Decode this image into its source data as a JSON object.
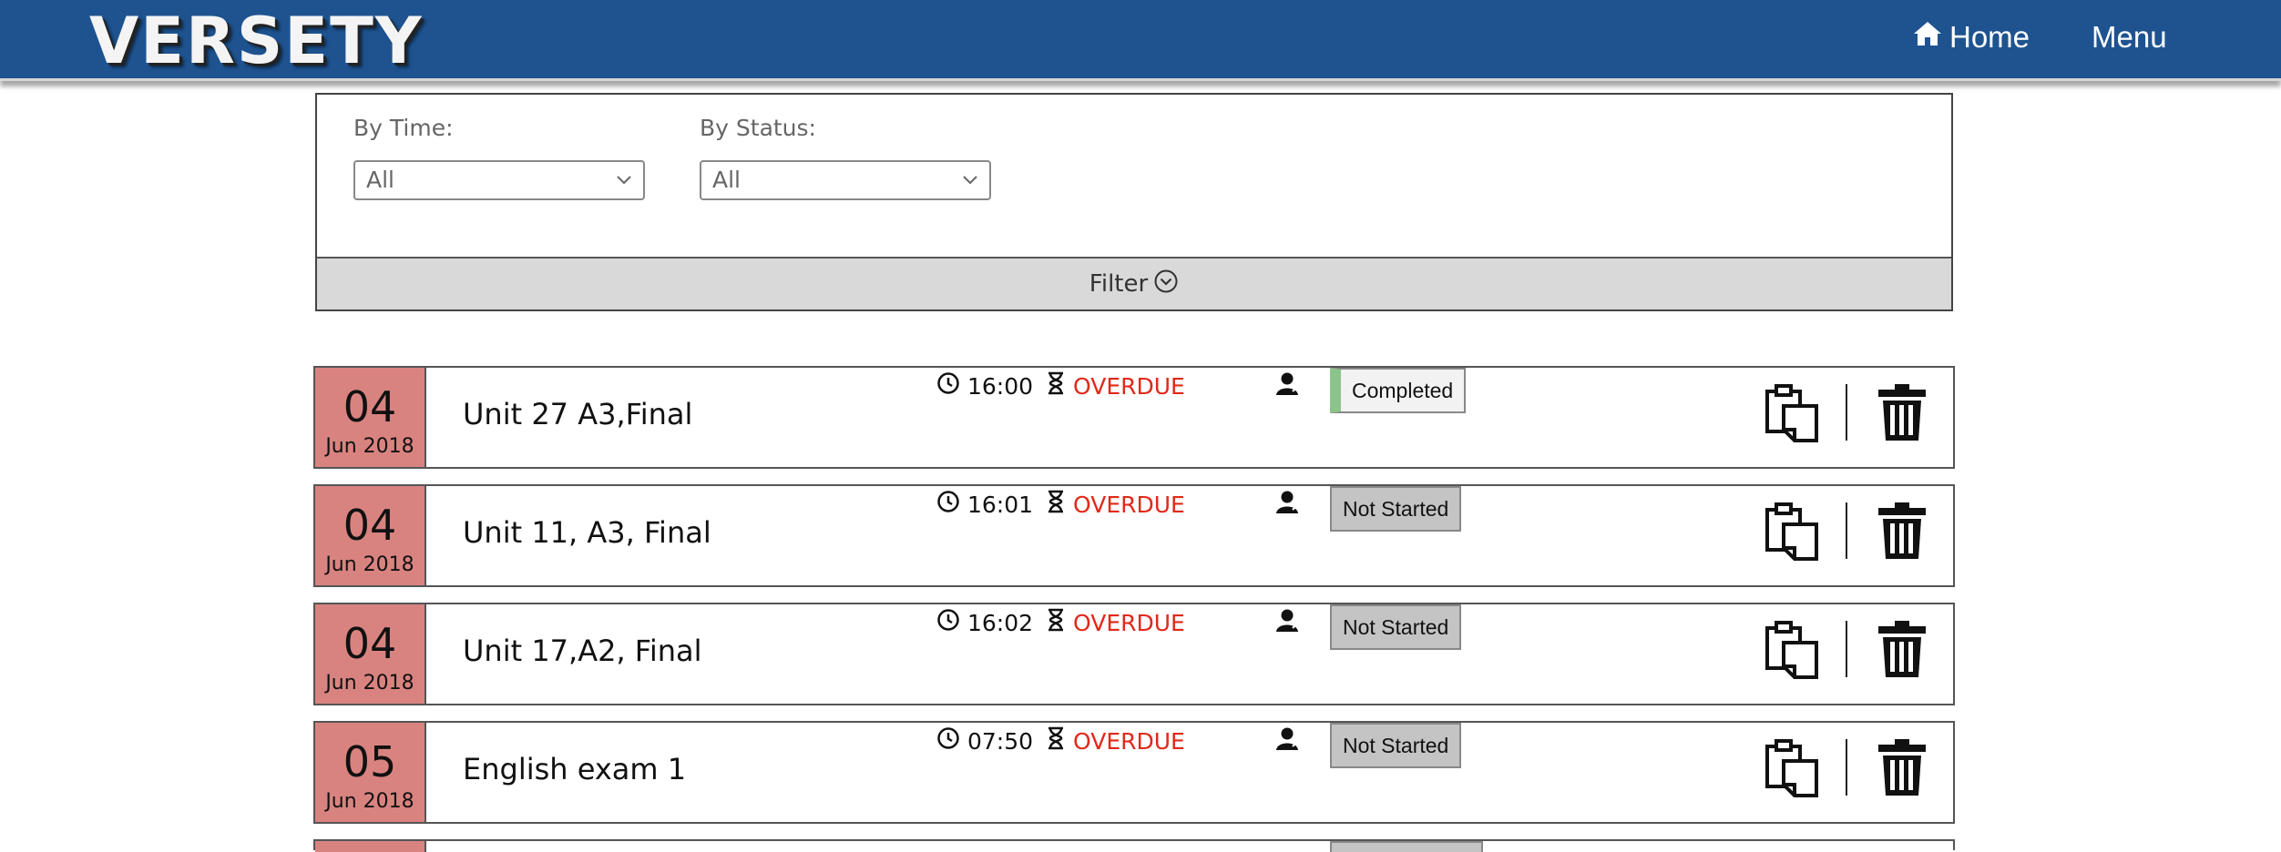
{
  "header": {
    "logo": "VERSETY",
    "home_label": "Home",
    "menu_label": "Menu"
  },
  "filters": {
    "time_label": "By Time:",
    "time_value": "All",
    "status_label": "By Status:",
    "status_value": "All",
    "toggle_label": "Filter"
  },
  "assignments": [
    {
      "day": "04",
      "month": "Jun 2018",
      "title": "Unit 27 A3,Final",
      "time": "16:00",
      "due_status": "OVERDUE",
      "status": "Completed"
    },
    {
      "day": "04",
      "month": "Jun 2018",
      "title": "Unit 11, A3, Final",
      "time": "16:01",
      "due_status": "OVERDUE",
      "status": "Not Started"
    },
    {
      "day": "04",
      "month": "Jun 2018",
      "title": "Unit 17,A2, Final",
      "time": "16:02",
      "due_status": "OVERDUE",
      "status": "Not Started"
    },
    {
      "day": "05",
      "month": "Jun 2018",
      "title": "English exam 1",
      "time": "07:50",
      "due_status": "OVERDUE",
      "status": "Not Started"
    }
  ],
  "colors": {
    "header_bg": "#1e5390",
    "date_bg": "#d98380",
    "overdue": "#e0291a",
    "completed_accent": "#8bc48b",
    "not_started_bg": "#c4c4c4"
  }
}
